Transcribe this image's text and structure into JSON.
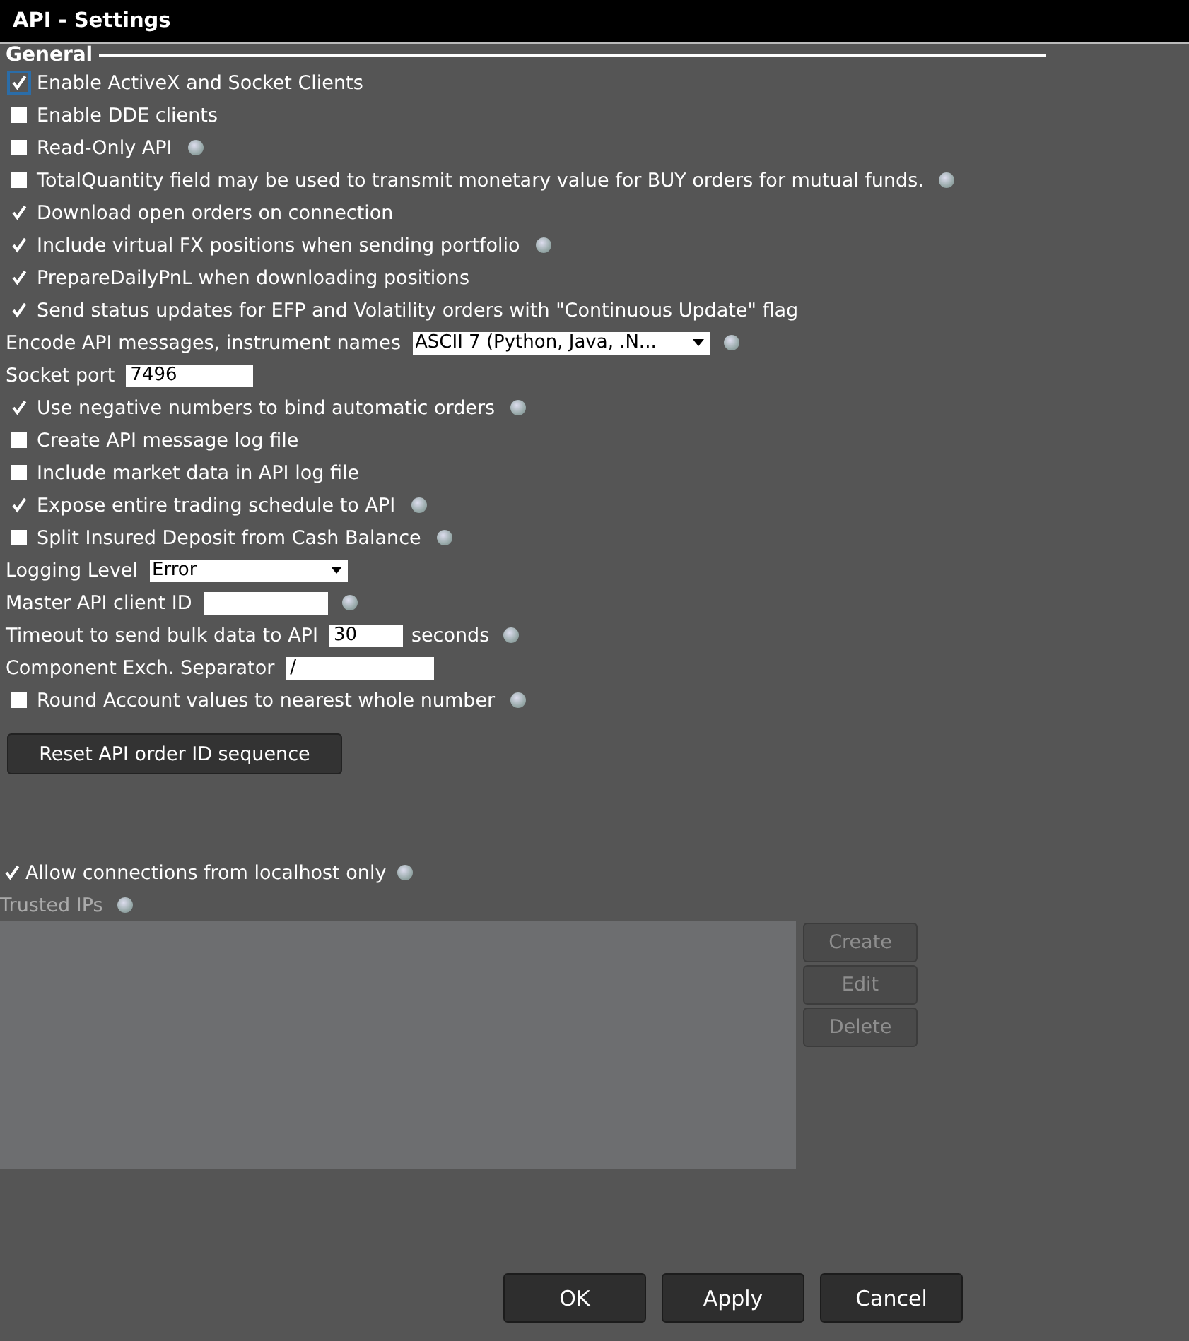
{
  "window": {
    "title": "API - Settings"
  },
  "section": {
    "title": "General"
  },
  "settings": [
    {
      "kind": "checkbox",
      "label": "Enable ActiveX and Socket Clients",
      "checked": true,
      "focused": true
    },
    {
      "kind": "checkbox",
      "label": "Enable DDE clients",
      "checked": false
    },
    {
      "kind": "checkbox",
      "label": "Read-Only API",
      "checked": false,
      "help": true
    },
    {
      "kind": "checkbox",
      "label": "TotalQuantity field may be used to transmit monetary value for BUY orders for mutual funds.",
      "checked": false,
      "help": true
    },
    {
      "kind": "checkbox",
      "label": "Download open orders on connection",
      "checked": true
    },
    {
      "kind": "checkbox",
      "label": "Include virtual FX positions when sending portfolio",
      "checked": true,
      "help": true
    },
    {
      "kind": "checkbox",
      "label": "PrepareDailyPnL when downloading positions",
      "checked": true
    },
    {
      "kind": "checkbox",
      "label": "Send status updates for EFP and Volatility orders with \"Continuous Update\" flag",
      "checked": true
    },
    {
      "kind": "select",
      "label": "Encode API messages, instrument names",
      "value": "ASCII 7 (Python, Java, .N...",
      "help": true
    },
    {
      "kind": "field",
      "label": "Socket port",
      "value": "7496"
    },
    {
      "kind": "checkbox",
      "label": "Use negative numbers to bind automatic orders",
      "checked": true,
      "help": true
    },
    {
      "kind": "checkbox",
      "label": "Create API message log file",
      "checked": false
    },
    {
      "kind": "checkbox",
      "label": "Include market data in API log file",
      "checked": false
    },
    {
      "kind": "checkbox",
      "label": "Expose entire trading schedule to API",
      "checked": true,
      "help": true
    },
    {
      "kind": "checkbox",
      "label": "Split Insured Deposit from Cash Balance",
      "checked": false,
      "help": true
    },
    {
      "kind": "select",
      "label": "Logging Level",
      "value": "Error"
    },
    {
      "kind": "field",
      "label": "Master API client ID",
      "help": true
    },
    {
      "kind": "field",
      "label": "Timeout to send bulk data to API",
      "value": "30",
      "suffix": "seconds",
      "help": true
    },
    {
      "kind": "field",
      "label": "Component Exch. Separator",
      "value": "/"
    },
    {
      "kind": "checkbox",
      "label": "Round Account values to nearest whole number",
      "checked": false,
      "help": true
    }
  ],
  "reset_button": "Reset API order ID sequence",
  "localhost": {
    "label": "Allow connections from localhost only",
    "checked": true,
    "help": true
  },
  "trusted_ips": {
    "label": "Trusted IPs",
    "help": true,
    "buttons": [
      {
        "label": "Create",
        "disabled": true
      },
      {
        "label": "Edit",
        "disabled": true
      },
      {
        "label": "Delete",
        "disabled": true
      }
    ]
  },
  "buttons": [
    "OK",
    "Apply",
    "Cancel"
  ]
}
